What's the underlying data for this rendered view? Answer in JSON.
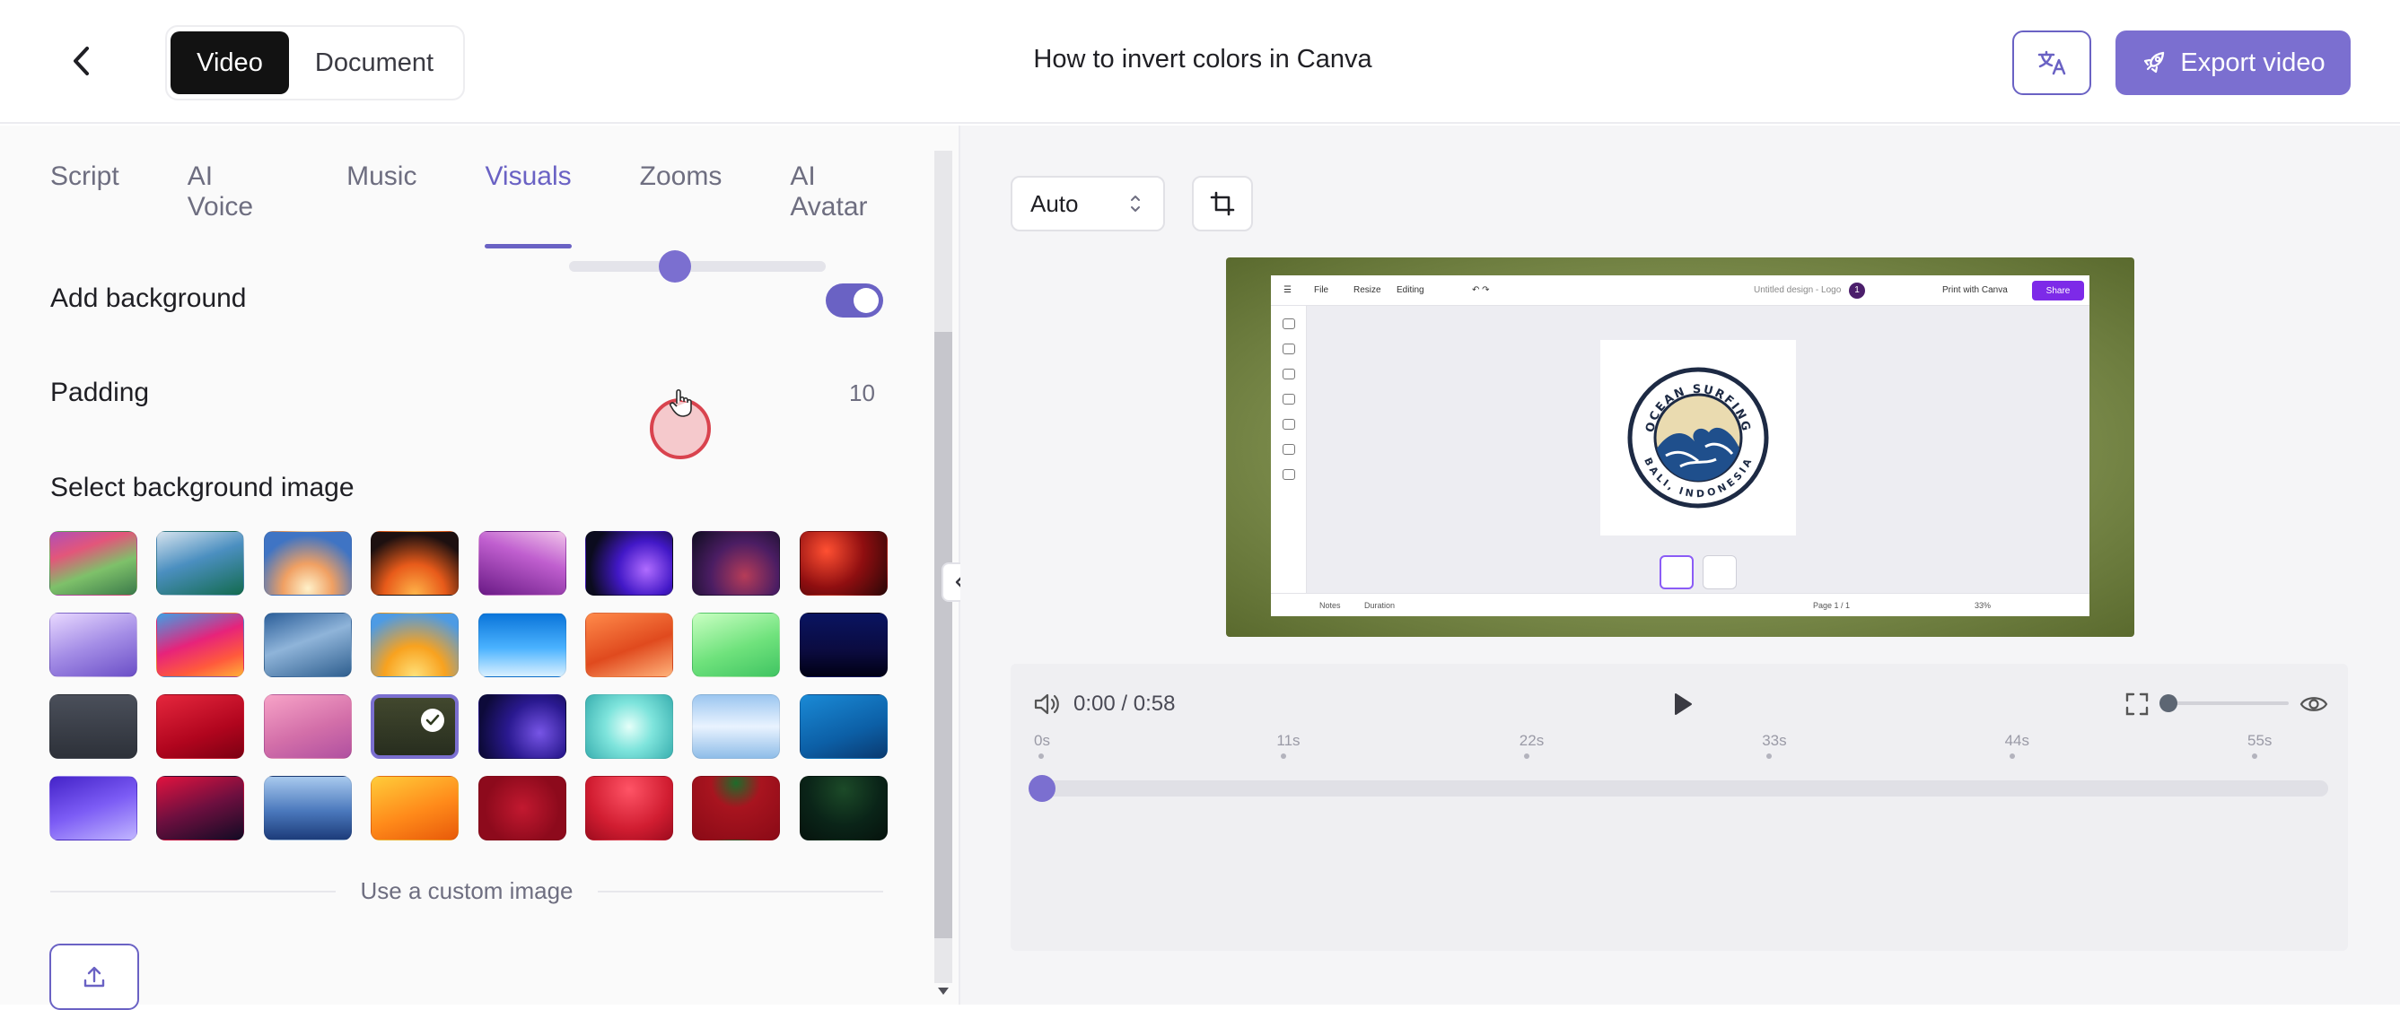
{
  "header": {
    "mode_video": "Video",
    "mode_document": "Document",
    "title": "How to invert colors in Canva",
    "export_label": "Export video"
  },
  "tabs": [
    {
      "label": "Script",
      "active": false
    },
    {
      "label": "AI Voice",
      "active": false
    },
    {
      "label": "Music",
      "active": false
    },
    {
      "label": "Visuals",
      "active": true
    },
    {
      "label": "Zooms",
      "active": false
    },
    {
      "label": "AI Avatar",
      "active": false
    }
  ],
  "visuals": {
    "add_background_label": "Add background",
    "add_background_on": true,
    "padding_label": "Padding",
    "padding_value": "10",
    "select_bg_label": "Select background image",
    "custom_image_label": "Use a custom image",
    "selected_index": 19
  },
  "preview": {
    "aspect_select": "Auto",
    "canva": {
      "file": "File",
      "resize": "Resize",
      "editing": "Editing",
      "design_name": "Untitled design - Logo",
      "print": "Print with Canva",
      "share": "Share",
      "notes": "Notes",
      "duration": "Duration",
      "page": "Page 1 / 1",
      "zoom": "33%"
    },
    "logo": {
      "top_text": "OCEAN SURFING",
      "bottom_text": "BALI, INDONESIA"
    }
  },
  "player": {
    "time": "0:00 / 0:58",
    "ruler": [
      "0s",
      "11s",
      "22s",
      "33s",
      "44s",
      "55s"
    ],
    "progress": 0.0
  },
  "colors": {
    "accent": "#7b6fd0",
    "accent_dark": "#6a62c4"
  }
}
